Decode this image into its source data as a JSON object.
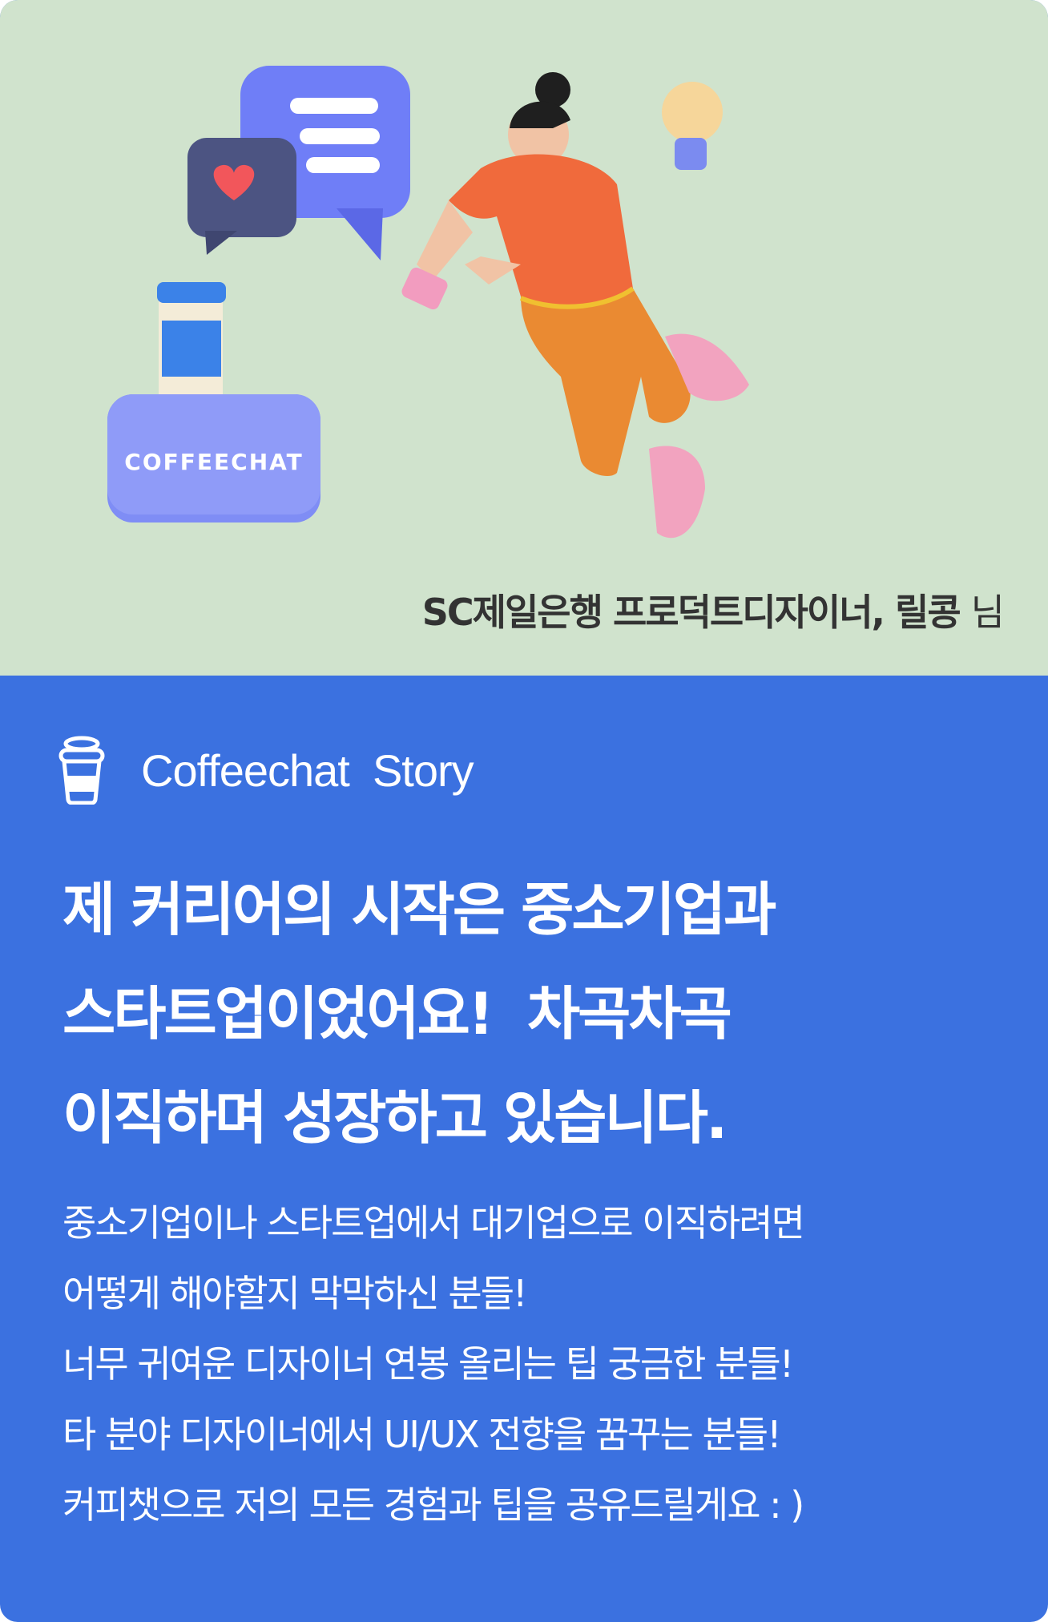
{
  "hero": {
    "badge_text": "COFFEECHAT",
    "author": "SC제일은행 프로덕트디자이너, 릴콩",
    "author_suffix": "님",
    "background_color": "#d0e3cd"
  },
  "brand": {
    "icon": "coffee-cup-icon",
    "label": "Coffeechat  Story"
  },
  "title_lines": [
    "제 커리어의 시작은 중소기업과",
    "스타트업이었어요!  차곡차곡",
    "이직하며 성장하고 있습니다."
  ],
  "body_lines": [
    "중소기업이나 스타트업에서 대기업으로 이직하려면",
    "어떻게 해야할지 막막하신 분들!",
    "너무 귀여운 디자이너 연봉 올리는 팁 궁금한 분들!",
    "타 분야 디자이너에서 UI/UX 전향을 꿈꾸는 분들!",
    "커피챗으로 저의 모든 경험과 팁을 공유드릴게요 : )"
  ],
  "accent_color": "#3b71e0"
}
